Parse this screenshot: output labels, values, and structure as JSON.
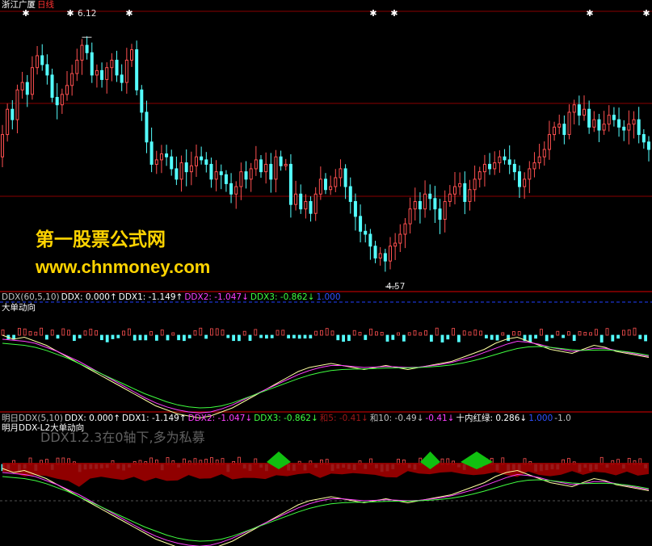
{
  "main": {
    "stock_name": "浙江广厦",
    "period": "日线",
    "high_label": "6.12",
    "low_label": "4.57",
    "colors": {
      "up": "#ff5050",
      "down": "#54ffff",
      "grid": "#8a0000",
      "title": "#ffffff",
      "period": "#ff3030"
    }
  },
  "watermark": {
    "line1": "第一股票公式网",
    "line2": "www.chnmoney.com"
  },
  "indicator1": {
    "header_items": [
      {
        "text": "DDX(60,5,10)",
        "color": "#c0c0c0"
      },
      {
        "text": "DDX: 0.000↑",
        "color": "#ffffff"
      },
      {
        "text": "DDX1: -1.149↑",
        "color": "#ffffff"
      },
      {
        "text": "DDX2: -1.047↓",
        "color": "#ff40ff"
      },
      {
        "text": "DDX3: -0.862↓",
        "color": "#40ff40"
      },
      {
        "text": "1.000",
        "color": "#3050ff"
      }
    ],
    "subtitle": "大单动向"
  },
  "indicator2": {
    "header_items": [
      {
        "text": "明日DDX(5,10)",
        "color": "#c0c0c0"
      },
      {
        "text": "DDX: 0.000↑",
        "color": "#ffffff"
      },
      {
        "text": "DDX1: -1.149↑",
        "color": "#ffffff"
      },
      {
        "text": "DDX2: -1.047↓",
        "color": "#ff40ff"
      },
      {
        "text": "DDX3: -0.862↓",
        "color": "#40ff40"
      },
      {
        "text": "和5: -0.41↓",
        "color": "#a01818"
      },
      {
        "text": "和10: -0.49↓",
        "color": "#c0c0c0"
      },
      {
        "text": "-0.41↓",
        "color": "#ff40ff"
      },
      {
        "text": "十内红绿: 0.286↓",
        "color": "#ffffff"
      },
      {
        "text": "1.000",
        "color": "#3050ff"
      },
      {
        "text": "-1.0",
        "color": "#c0c0c0"
      }
    ],
    "subtitle": "明月DDX-L2大单动向",
    "overlay": "DDX1.2.3在0轴下,多为私募"
  },
  "chart_data": [
    {
      "type": "candlestick",
      "title": "浙江广厦 日线",
      "ylim": [
        4.4,
        6.3
      ],
      "high_marker": 6.12,
      "low_marker": 4.57,
      "close": [
        5.45,
        5.62,
        5.55,
        5.75,
        5.8,
        5.72,
        5.9,
        5.98,
        5.92,
        5.85,
        5.7,
        5.65,
        5.72,
        5.78,
        5.86,
        5.95,
        6.05,
        6.0,
        5.85,
        5.88,
        5.82,
        5.9,
        5.95,
        5.85,
        5.8,
        5.95,
        6.02,
        5.75,
        5.6,
        5.4,
        5.25,
        5.28,
        5.32,
        5.3,
        5.22,
        5.15,
        5.26,
        5.2,
        5.24,
        5.3,
        5.28,
        5.25,
        5.15,
        5.2,
        5.18,
        5.12,
        5.05,
        5.1,
        5.2,
        5.15,
        5.22,
        5.28,
        5.2,
        5.25,
        5.15,
        5.3,
        5.24,
        5.25,
        4.98,
        5.05,
        4.95,
        5.0,
        4.92,
        5.05,
        5.15,
        5.08,
        5.1,
        5.16,
        5.22,
        5.1,
        5.0,
        4.9,
        4.8,
        4.78,
        4.7,
        4.62,
        4.65,
        4.6,
        4.7,
        4.72,
        4.78,
        4.85,
        4.95,
        5.0,
        4.95,
        5.05,
        5.02,
        4.95,
        4.88,
        5.0,
        5.05,
        5.1,
        5.12,
        5.0,
        5.08,
        5.15,
        5.2,
        5.25,
        5.22,
        5.26,
        5.3,
        5.28,
        5.25,
        5.2,
        5.1,
        5.15,
        5.22,
        5.26,
        5.3,
        5.35,
        5.45,
        5.5,
        5.52,
        5.45,
        5.6,
        5.65,
        5.58,
        5.62,
        5.5,
        5.55,
        5.48,
        5.52,
        5.58,
        5.55,
        5.5,
        5.48,
        5.52,
        5.55,
        5.45,
        5.4,
        5.35
      ],
      "open": [
        5.3,
        5.45,
        5.62,
        5.55,
        5.75,
        5.8,
        5.72,
        5.9,
        5.98,
        5.92,
        5.85,
        5.7,
        5.65,
        5.72,
        5.78,
        5.86,
        5.95,
        6.05,
        6.0,
        5.85,
        5.88,
        5.82,
        5.9,
        5.95,
        5.85,
        5.8,
        5.95,
        6.02,
        5.75,
        5.6,
        5.4,
        5.25,
        5.28,
        5.32,
        5.3,
        5.22,
        5.15,
        5.26,
        5.2,
        5.24,
        5.3,
        5.28,
        5.25,
        5.15,
        5.2,
        5.18,
        5.12,
        5.05,
        5.1,
        5.2,
        5.15,
        5.22,
        5.28,
        5.2,
        5.25,
        5.15,
        5.3,
        5.24,
        5.25,
        4.98,
        5.05,
        4.95,
        5.0,
        4.92,
        5.05,
        5.15,
        5.08,
        5.1,
        5.16,
        5.22,
        5.1,
        5.0,
        4.9,
        4.8,
        4.78,
        4.7,
        4.62,
        4.65,
        4.6,
        4.7,
        4.72,
        4.78,
        4.85,
        4.95,
        5.0,
        4.95,
        5.05,
        5.02,
        4.95,
        4.88,
        5.0,
        5.05,
        5.1,
        5.12,
        5.0,
        5.08,
        5.15,
        5.2,
        5.25,
        5.22,
        5.26,
        5.3,
        5.28,
        5.25,
        5.2,
        5.1,
        5.15,
        5.22,
        5.26,
        5.3,
        5.35,
        5.45,
        5.5,
        5.52,
        5.45,
        5.6,
        5.65,
        5.58,
        5.62,
        5.5,
        5.55,
        5.48,
        5.52,
        5.58,
        5.55,
        5.5,
        5.48,
        5.52,
        5.55,
        5.45,
        5.4
      ]
    },
    {
      "type": "line",
      "title": "大单动向",
      "series": [
        {
          "name": "DDX1",
          "color": "#ffffa0",
          "values": [
            0.6,
            0.4,
            0.5,
            0.3,
            0.1,
            -0.2,
            -0.5,
            -0.8,
            -1.1,
            -1.4,
            -1.7,
            -2.0,
            -2.3,
            -2.6,
            -2.9,
            -3.1,
            -3.3,
            -3.4,
            -3.5,
            -3.4,
            -3.2,
            -3.0,
            -2.7,
            -2.4,
            -2.1,
            -1.8,
            -1.5,
            -1.2,
            -1.0,
            -0.9,
            -0.8,
            -0.9,
            -1.0,
            -1.1,
            -1.0,
            -0.9,
            -1.0,
            -1.1,
            -1.0,
            -0.9,
            -0.8,
            -0.7,
            -0.5,
            -0.3,
            -0.1,
            0.2,
            0.4,
            0.5,
            0.3,
            0.1,
            -0.1,
            -0.2,
            -0.3,
            -0.1,
            0.1,
            0.0,
            -0.2,
            -0.3,
            -0.4,
            -0.5
          ]
        },
        {
          "name": "DDX2",
          "color": "#ff40ff",
          "values": [
            0.4,
            0.35,
            0.3,
            0.2,
            0.0,
            -0.2,
            -0.45,
            -0.7,
            -1.0,
            -1.3,
            -1.6,
            -1.9,
            -2.2,
            -2.5,
            -2.75,
            -2.95,
            -3.1,
            -3.2,
            -3.25,
            -3.2,
            -3.05,
            -2.85,
            -2.6,
            -2.35,
            -2.1,
            -1.85,
            -1.6,
            -1.35,
            -1.15,
            -1.0,
            -0.9,
            -0.9,
            -0.95,
            -1.0,
            -0.98,
            -0.95,
            -0.97,
            -1.0,
            -0.98,
            -0.92,
            -0.85,
            -0.75,
            -0.6,
            -0.45,
            -0.25,
            -0.05,
            0.15,
            0.3,
            0.25,
            0.15,
            0.0,
            -0.1,
            -0.2,
            -0.15,
            -0.05,
            -0.05,
            -0.15,
            -0.25,
            -0.35,
            -0.45
          ]
        },
        {
          "name": "DDX3",
          "color": "#40ff40",
          "values": [
            0.2,
            0.15,
            0.1,
            0.0,
            -0.15,
            -0.35,
            -0.55,
            -0.8,
            -1.05,
            -1.3,
            -1.55,
            -1.8,
            -2.05,
            -2.3,
            -2.5,
            -2.7,
            -2.85,
            -2.95,
            -3.0,
            -2.98,
            -2.9,
            -2.75,
            -2.55,
            -2.35,
            -2.15,
            -1.95,
            -1.75,
            -1.55,
            -1.38,
            -1.25,
            -1.15,
            -1.1,
            -1.08,
            -1.07,
            -1.05,
            -1.03,
            -1.02,
            -1.02,
            -1.0,
            -0.97,
            -0.93,
            -0.87,
            -0.78,
            -0.66,
            -0.52,
            -0.36,
            -0.2,
            -0.06,
            0.02,
            0.04,
            0.0,
            -0.06,
            -0.12,
            -0.15,
            -0.14,
            -0.13,
            -0.16,
            -0.22,
            -0.3,
            -0.4
          ]
        }
      ]
    },
    {
      "type": "area",
      "title": "明月DDX-L2大单动向"
    }
  ]
}
